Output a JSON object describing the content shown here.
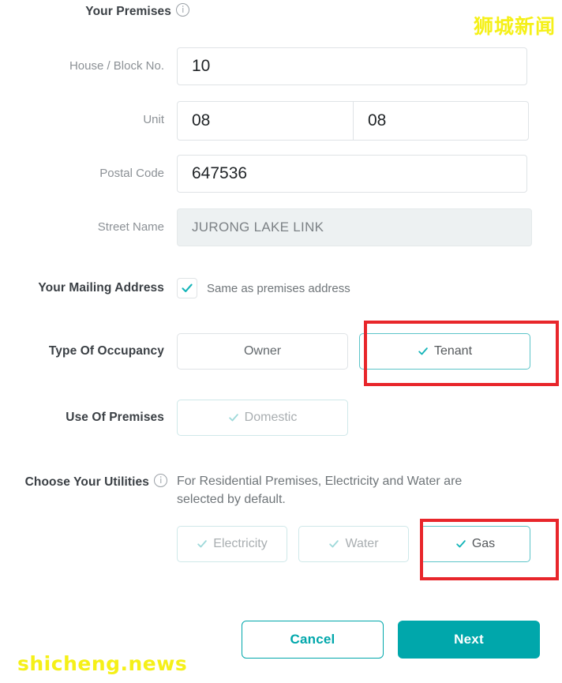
{
  "section_premises": {
    "title": "Your Premises",
    "info_icon": "info-icon"
  },
  "fields": {
    "house_block": {
      "label": "House / Block No.",
      "value": "10"
    },
    "unit": {
      "label": "Unit",
      "floor_value": "08",
      "number_value": "08"
    },
    "postal_code": {
      "label": "Postal Code",
      "value": "647536"
    },
    "street_name": {
      "label": "Street Name",
      "value": "JURONG LAKE LINK"
    }
  },
  "mailing_address": {
    "label": "Your Mailing Address",
    "checkbox_label": "Same as premises address",
    "checked": true,
    "check_icon": "check-icon"
  },
  "occupancy": {
    "label": "Type Of Occupancy",
    "options": [
      {
        "label": "Owner",
        "selected": false
      },
      {
        "label": "Tenant",
        "selected": true
      }
    ]
  },
  "use_of_premises": {
    "label": "Use Of Premises",
    "options": [
      {
        "label": "Domestic",
        "selected": true,
        "disabled": true
      }
    ]
  },
  "utilities": {
    "label": "Choose Your Utilities",
    "info_icon": "info-icon",
    "helper_text": "For Residential Premises, Electricity and Water are selected by default.",
    "options": [
      {
        "label": "Electricity",
        "selected": true,
        "disabled": true
      },
      {
        "label": "Water",
        "selected": true,
        "disabled": true
      },
      {
        "label": "Gas",
        "selected": true,
        "disabled": false
      }
    ]
  },
  "footer": {
    "cancel_label": "Cancel",
    "next_label": "Next"
  },
  "watermarks": {
    "top_right": "狮城新闻",
    "bottom_left": "shicheng.news"
  },
  "colors": {
    "accent_teal": "#00a7ab",
    "tick_teal": "#13b4b8",
    "muted_border": "#cfe8e9",
    "annotation_red": "#e8262b",
    "watermark_yellow": "#f5f018",
    "label_gray": "#8c9196",
    "disabled_field_bg": "#edf1f2"
  }
}
